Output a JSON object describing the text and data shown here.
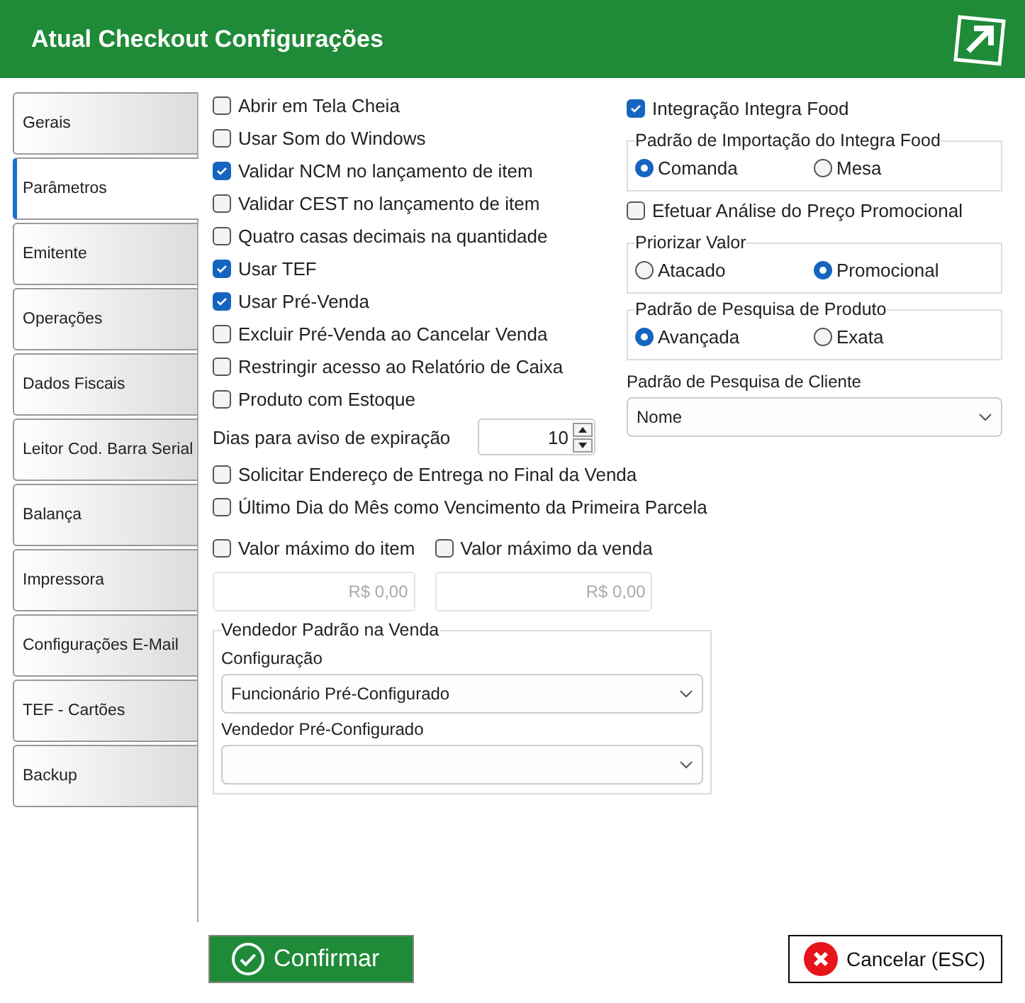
{
  "window": {
    "title": "Atual Checkout Configurações"
  },
  "tabs": [
    {
      "label": "Gerais",
      "selected": false
    },
    {
      "label": "Parâmetros",
      "selected": true
    },
    {
      "label": "Emitente",
      "selected": false
    },
    {
      "label": "Operações",
      "selected": false
    },
    {
      "label": "Dados Fiscais",
      "selected": false
    },
    {
      "label": "Leitor Cod. Barra Serial",
      "selected": false
    },
    {
      "label": "Balança",
      "selected": false
    },
    {
      "label": "Impressora",
      "selected": false
    },
    {
      "label": "Configurações E-Mail",
      "selected": false
    },
    {
      "label": "TEF - Cartões",
      "selected": false
    },
    {
      "label": "Backup",
      "selected": false
    }
  ],
  "options": [
    {
      "label": "Abrir em Tela Cheia",
      "checked": false
    },
    {
      "label": "Usar Som do Windows",
      "checked": false
    },
    {
      "label": "Validar NCM no lançamento de item",
      "checked": true
    },
    {
      "label": "Validar CEST no lançamento de item",
      "checked": false
    },
    {
      "label": "Quatro casas decimais na quantidade",
      "checked": false
    },
    {
      "label": "Usar TEF",
      "checked": true
    },
    {
      "label": "Usar Pré-Venda",
      "checked": true
    },
    {
      "label": "Excluir Pré-Venda ao Cancelar Venda",
      "checked": false
    },
    {
      "label": "Restringir acesso ao Relatório de Caixa",
      "checked": false
    },
    {
      "label": "Produto com Estoque",
      "checked": false
    }
  ],
  "expiration": {
    "label": "Dias para aviso de expiração",
    "value": "10"
  },
  "options_2": [
    {
      "label": "Solicitar Endereço de Entrega no Final da Venda",
      "checked": false
    },
    {
      "label": "Último Dia do Mês como Vencimento da Primeira Parcela",
      "checked": false
    }
  ],
  "limits": [
    {
      "label": "Valor máximo do item",
      "checked": false,
      "placeholder": "R$ 0,00"
    },
    {
      "label": "Valor máximo da venda",
      "checked": false,
      "placeholder": "R$ 0,00"
    }
  ],
  "seller_group": {
    "title": "Vendedor Padrão na Venda",
    "fields": [
      {
        "label": "Configuração",
        "value": "Funcionário Pré-Configurado"
      },
      {
        "label": "Vendedor Pré-Configurado"
      }
    ]
  },
  "integra_food": {
    "label": "Integração Integra Food",
    "checked": true
  },
  "import_group": {
    "title": "Padrão de Importação do Integra Food",
    "options": [
      {
        "label": "Comanda",
        "selected": true
      },
      {
        "label": "Mesa",
        "selected": false
      }
    ]
  },
  "promo_analysis": {
    "label": "Efetuar Análise do Preço Promocional",
    "checked": false
  },
  "priority_group": {
    "title": "Priorizar Valor",
    "options": [
      {
        "label": "Atacado",
        "selected": false
      },
      {
        "label": "Promocional",
        "selected": true
      }
    ]
  },
  "product_search_group": {
    "title": "Padrão de Pesquisa de Produto",
    "options": [
      {
        "label": "Avançada",
        "selected": true
      },
      {
        "label": "Exata",
        "selected": false
      }
    ]
  },
  "client_search": {
    "label": "Padrão de Pesquisa de Cliente",
    "value": "Nome"
  },
  "buttons": [
    {
      "label": "Confirmar",
      "kind": "confirm"
    },
    {
      "label": "Cancelar (ESC)",
      "kind": "cancel"
    }
  ]
}
